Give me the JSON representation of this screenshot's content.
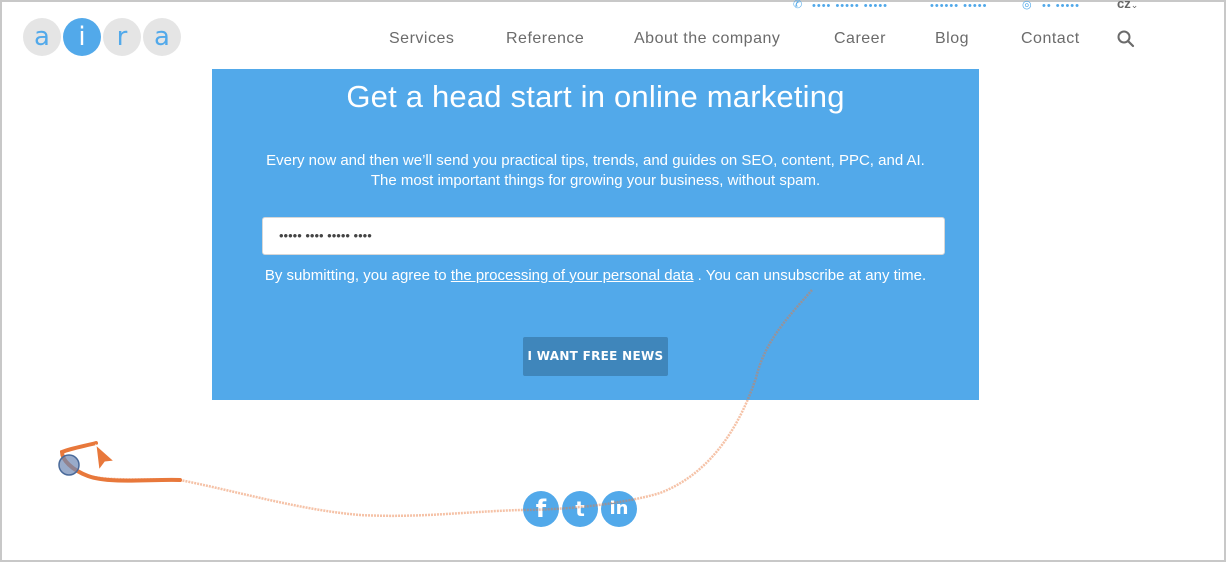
{
  "topbar": {
    "phone_icon": "phone-icon",
    "phone": "•••• ••••• •••••",
    "email": "•••••• •••••",
    "user_icon": "user-icon",
    "login": "•• •••••",
    "language": "cz"
  },
  "logo": {
    "letters": [
      "a",
      "i",
      "r",
      "a"
    ]
  },
  "nav": {
    "items": [
      "Services",
      "Reference",
      "About the company",
      "Career",
      "Blog",
      "Contact"
    ]
  },
  "newsletter": {
    "title": "Get a head start in online marketing",
    "description": "Every now and then we’ll send you practical tips, trends, and guides on SEO, content, PPC, and AI. The most important things for growing your business, without spam.",
    "email_value": "••••• •••• ••••• ••••",
    "consent_before": "By submitting, you agree to ",
    "consent_link": "the processing of your personal data",
    "consent_after": " . You can unsubscribe at any time.",
    "submit_label": "I WANT FREE NEWS"
  },
  "social": [
    {
      "label": "f",
      "icon": "facebook-icon"
    },
    {
      "label": "t",
      "icon": "twitter-icon"
    },
    {
      "label": "in",
      "icon": "linkedin-icon"
    }
  ],
  "colors": {
    "brand": "#52a9ea",
    "button": "#3f86bb",
    "trail": "#e8783b"
  }
}
